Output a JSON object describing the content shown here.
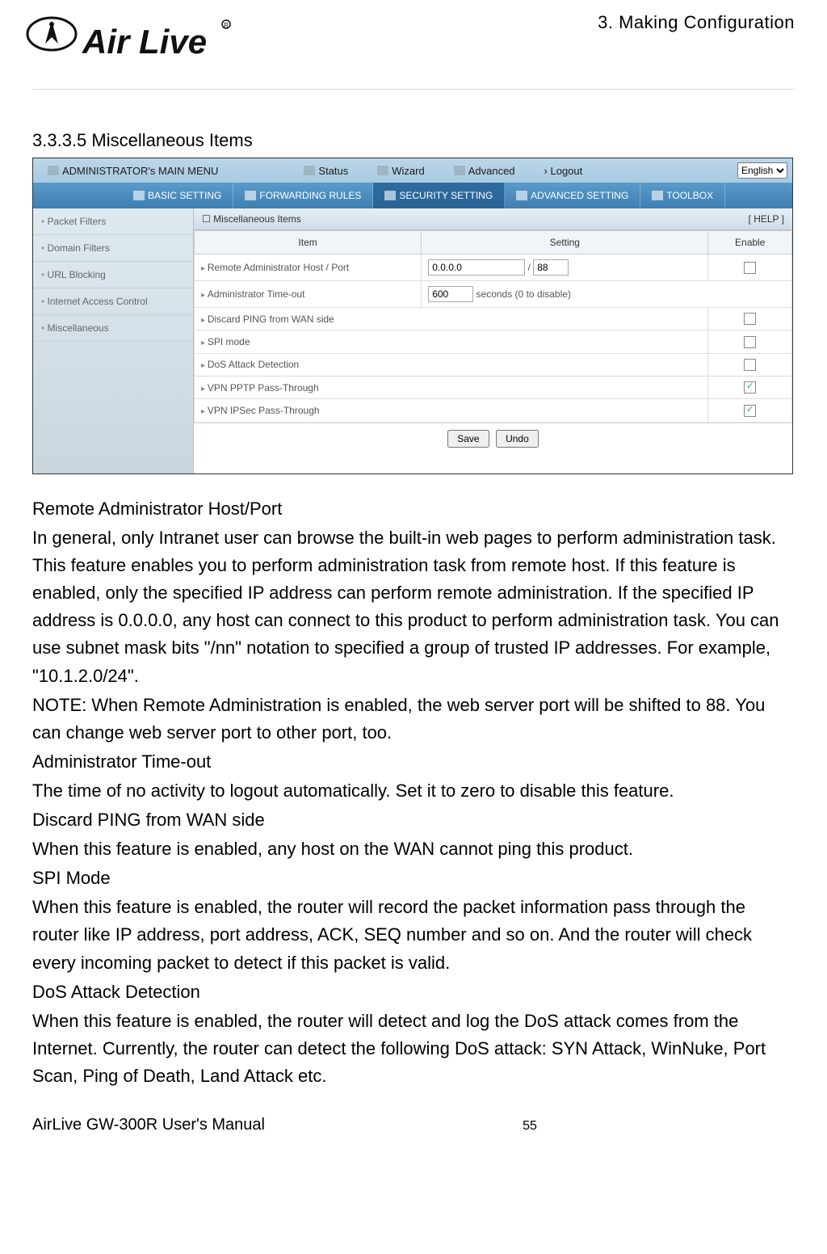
{
  "chapter": "3. Making Configuration",
  "section_title": "3.3.3.5 Miscellaneous Items",
  "screenshot": {
    "topbar": {
      "menu_label": "ADMINISTRATOR's MAIN MENU",
      "status": "Status",
      "wizard": "Wizard",
      "advanced": "Advanced",
      "logout": "› Logout",
      "language": "English"
    },
    "tabs": {
      "basic": "BASIC SETTING",
      "forwarding": "FORWARDING RULES",
      "security": "SECURITY SETTING",
      "advanced": "ADVANCED SETTING",
      "toolbox": "TOOLBOX"
    },
    "sidebar": {
      "items": [
        {
          "label": "Packet Filters"
        },
        {
          "label": "Domain Filters"
        },
        {
          "label": "URL Blocking"
        },
        {
          "label": "Internet Access Control"
        },
        {
          "label": "Miscellaneous"
        }
      ]
    },
    "panel": {
      "title": "Miscellaneous Items",
      "help": "[ HELP ]",
      "col_item": "Item",
      "col_setting": "Setting",
      "col_enable": "Enable",
      "rows": {
        "remote": {
          "label": "Remote Administrator Host / Port",
          "host": "0.0.0.0",
          "sep": "/",
          "port": "88"
        },
        "timeout": {
          "label": "Administrator Time-out",
          "value": "600",
          "suffix": "seconds (0 to disable)"
        },
        "ping": {
          "label": "Discard PING from WAN side"
        },
        "spi": {
          "label": "SPI mode"
        },
        "dos": {
          "label": "DoS Attack Detection"
        },
        "pptp": {
          "label": "VPN PPTP Pass-Through"
        },
        "ipsec": {
          "label": "VPN IPSec Pass-Through"
        }
      },
      "save": "Save",
      "undo": "Undo"
    }
  },
  "body": {
    "h1": "Remote Administrator Host/Port",
    "p1": "In general, only Intranet user can browse the built-in web pages to perform administration task. This feature enables you to perform administration task from remote host. If this feature is enabled, only the specified IP address can perform remote administration. If the specified IP address is 0.0.0.0, any host can connect to this product to perform administration task. You can use subnet mask bits \"/nn\" notation to specified a group of trusted IP addresses. For example, \"10.1.2.0/24\".",
    "p2": "NOTE: When Remote Administration is enabled, the web server port will be shifted to 88. You can change web server port to other port, too.",
    "h2": "Administrator Time-out",
    "p3": "The time of no activity to logout automatically. Set it to zero to disable this feature.",
    "h3": "Discard PING from WAN side",
    "p4": "When this feature is enabled, any host on the WAN cannot ping this product.",
    "h4": "SPI Mode",
    "p5": "When this feature is enabled, the router will record the packet information pass through the router like IP address, port address, ACK, SEQ number and so on. And the router will check every incoming packet to detect if this packet is valid.",
    "h5": "DoS Attack Detection",
    "p6": "When this feature is enabled, the router will detect and log the DoS attack comes from the Internet. Currently, the router can detect the following DoS attack: SYN Attack, WinNuke, Port Scan, Ping of Death, Land Attack etc."
  },
  "footer": {
    "manual": "AirLive GW-300R User's Manual",
    "page": "55"
  }
}
